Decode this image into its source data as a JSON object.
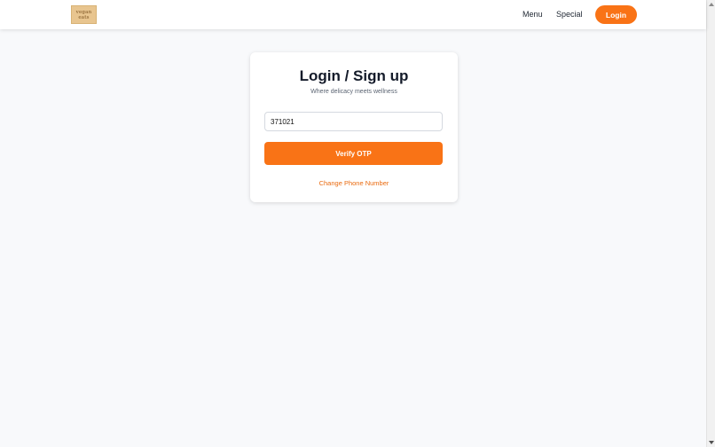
{
  "header": {
    "logo_line1": "vegan",
    "logo_line2": "eats",
    "nav": {
      "menu_label": "Menu",
      "special_label": "Special"
    },
    "login_label": "Login"
  },
  "card": {
    "title": "Login / Sign up",
    "subtitle": "Where delicacy meets wellness",
    "otp_value": "371021",
    "verify_label": "Verify OTP",
    "change_label": "Change Phone Number"
  },
  "colors": {
    "accent": "#f97316",
    "background": "#f8f9fb",
    "card": "#ffffff"
  }
}
